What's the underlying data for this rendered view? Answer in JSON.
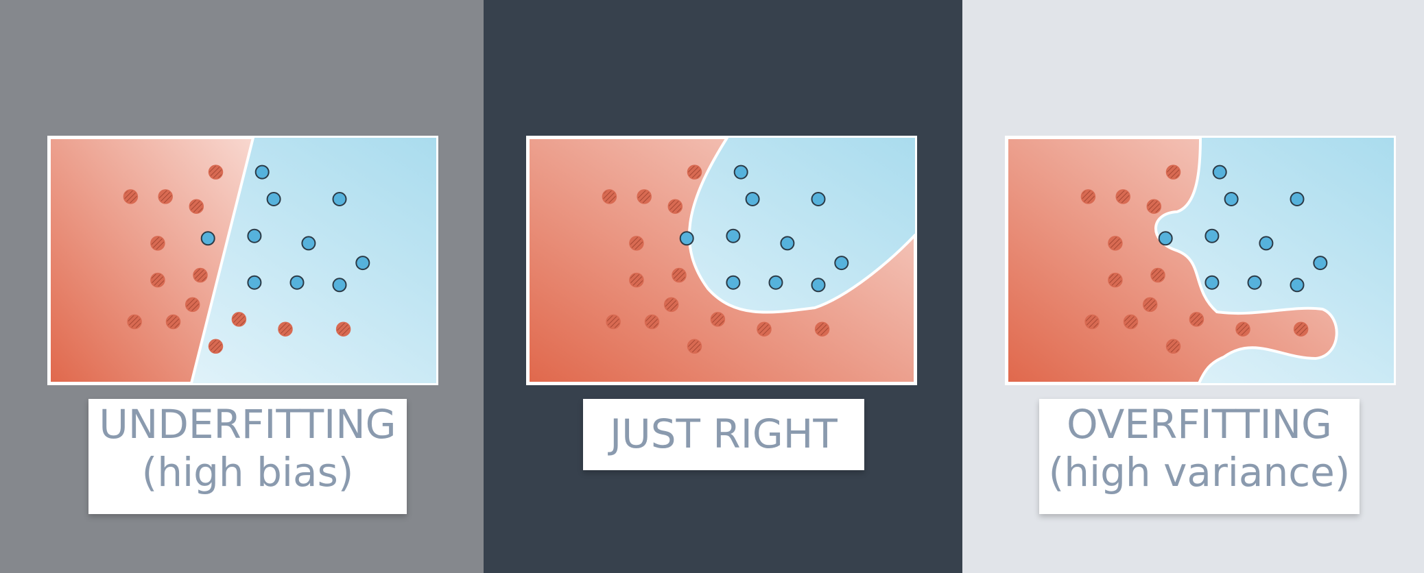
{
  "colors": {
    "background_left": "#85888d",
    "background_middle": "#37414d",
    "background_right": "#e1e4e9",
    "red_region_dark": "#e0684c",
    "red_region_light": "#f8d8d0",
    "blue_region_dark": "#aadcee",
    "blue_region_light": "#ecf7fc",
    "red_point": "#d86a52",
    "blue_point": "#56b2dc",
    "point_outline": "#2b3a46",
    "boundary": "#ffffff",
    "caption_text": "#8a9aae"
  },
  "panels": [
    {
      "label_line1": "UNDERFITTING",
      "label_line2": "(high bias)",
      "boundary_shape": "straight line",
      "points_shared": true
    },
    {
      "label_line1": "JUST RIGHT",
      "label_line2": "",
      "boundary_shape": "smooth curve",
      "points_shared": true
    },
    {
      "label_line1": "OVERFITTING",
      "label_line2": "(high variance)",
      "boundary_shape": "wiggly curve",
      "points_shared": true
    }
  ],
  "points": {
    "red": [
      [
        0.22,
        0.75
      ],
      [
        0.32,
        0.75
      ],
      [
        0.43,
        0.85
      ],
      [
        0.21,
        0.24
      ],
      [
        0.3,
        0.24
      ],
      [
        0.28,
        0.43
      ],
      [
        0.28,
        0.58
      ],
      [
        0.38,
        0.28
      ],
      [
        0.39,
        0.56
      ],
      [
        0.37,
        0.68
      ],
      [
        0.43,
        0.14
      ],
      [
        0.49,
        0.74
      ],
      [
        0.61,
        0.78
      ],
      [
        0.76,
        0.78
      ]
    ],
    "blue": [
      [
        0.55,
        0.14
      ],
      [
        0.58,
        0.25
      ],
      [
        0.75,
        0.25
      ],
      [
        0.41,
        0.41
      ],
      [
        0.53,
        0.4
      ],
      [
        0.67,
        0.43
      ],
      [
        0.53,
        0.59
      ],
      [
        0.64,
        0.59
      ],
      [
        0.75,
        0.6
      ],
      [
        0.81,
        0.51
      ]
    ]
  }
}
